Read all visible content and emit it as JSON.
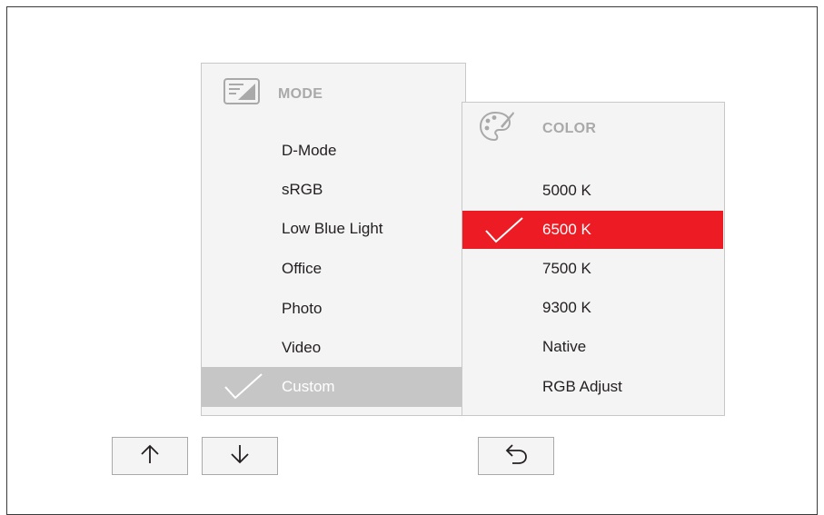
{
  "mode_menu": {
    "title": "MODE",
    "icon": "picture-mode-icon",
    "items": [
      {
        "label": "D-Mode",
        "selected": false
      },
      {
        "label": "sRGB",
        "selected": false
      },
      {
        "label": "Low Blue Light",
        "selected": false
      },
      {
        "label": "Office",
        "selected": false
      },
      {
        "label": "Photo",
        "selected": false
      },
      {
        "label": "Video",
        "selected": false
      },
      {
        "label": "Custom",
        "selected": true
      }
    ]
  },
  "color_menu": {
    "title": "COLOR",
    "icon": "palette-icon",
    "items": [
      {
        "label": "5000 K",
        "selected": false
      },
      {
        "label": "6500 K",
        "selected": true
      },
      {
        "label": "7500 K",
        "selected": false
      },
      {
        "label": "9300 K",
        "selected": false
      },
      {
        "label": "Native",
        "selected": false
      },
      {
        "label": "RGB Adjust",
        "selected": false
      }
    ]
  },
  "buttons": {
    "up_icon": "arrow-up-icon",
    "down_icon": "arrow-down-icon",
    "back_icon": "return-icon"
  },
  "colors": {
    "highlight_red": "#ed1c24",
    "highlight_gray": "#c6c6c6",
    "panel_bg": "#f4f4f4"
  }
}
